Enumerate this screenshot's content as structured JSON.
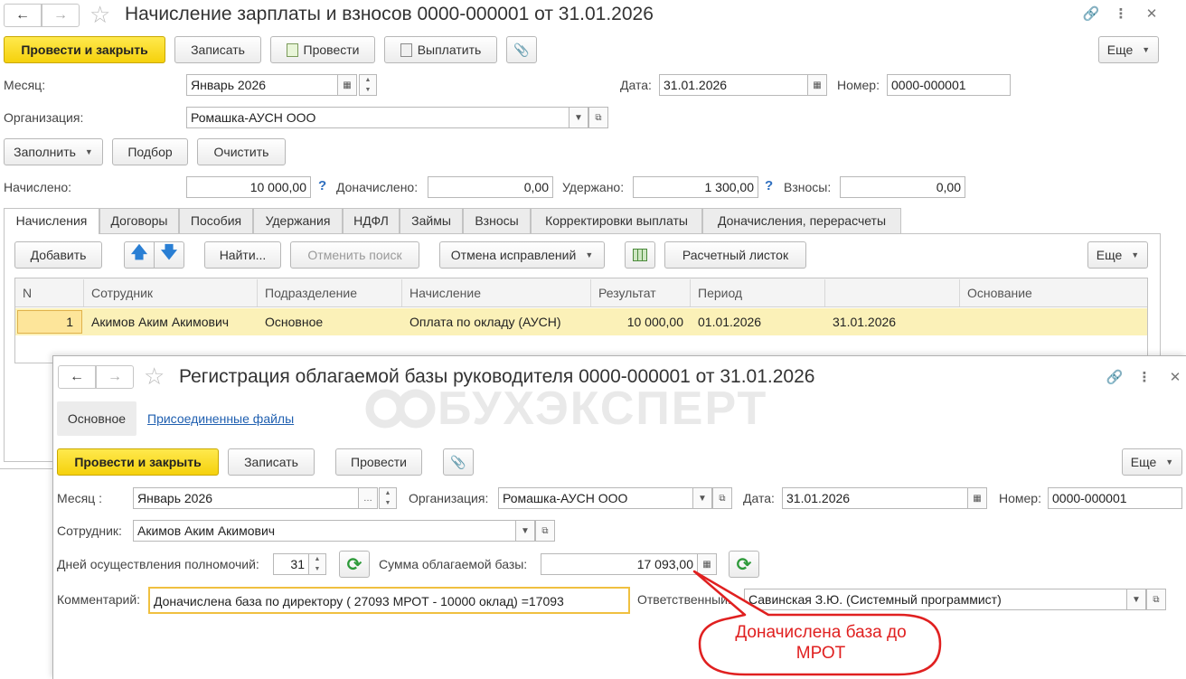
{
  "main": {
    "title": "Начисление зарплаты и взносов 0000-000001 от 31.01.2026",
    "toolbar": {
      "post_close": "Провести и закрыть",
      "save": "Записать",
      "post": "Провести",
      "pay": "Выплатить",
      "more": "Еще"
    },
    "month_label": "Месяц:",
    "month_value": "Январь 2026",
    "date_label": "Дата:",
    "date_value": "31.01.2026",
    "number_label": "Номер:",
    "number_value": "0000-000001",
    "org_label": "Организация:",
    "org_value": "Ромашка-АУСН ООО",
    "fill": "Заполнить",
    "select": "Подбор",
    "clear": "Очистить",
    "accrued_label": "Начислено:",
    "accrued_value": "10 000,00",
    "additional_label": "Доначислено:",
    "additional_value": "0,00",
    "withheld_label": "Удержано:",
    "withheld_value": "1 300,00",
    "contrib_label": "Взносы:",
    "contrib_value": "0,00",
    "q": "?",
    "tabs": [
      "Начисления",
      "Договоры",
      "Пособия",
      "Удержания",
      "НДФЛ",
      "Займы",
      "Взносы",
      "Корректировки выплаты",
      "Доначисления, перерасчеты"
    ],
    "table_toolbar": {
      "add": "Добавить",
      "find": "Найти...",
      "cancel_search": "Отменить поиск",
      "cancel_corrections": "Отмена исправлений",
      "payslip": "Расчетный листок",
      "more": "Еще"
    },
    "table": {
      "headers": [
        "N",
        "Сотрудник",
        "Подразделение",
        "Начисление",
        "Результат",
        "Период",
        "",
        "Основание"
      ],
      "rows": [
        [
          "1",
          "Акимов Аким Акимович",
          "Основное",
          "Оплата по окладу (АУСН)",
          "10 000,00",
          "01.01.2026",
          "31.01.2026",
          ""
        ]
      ]
    }
  },
  "dialog": {
    "title": "Регистрация облагаемой базы руководителя 0000-000001 от 31.01.2026",
    "tab_main": "Основное",
    "tab_files": "Присоединенные файлы",
    "watermark": "БУХЭКСПЕРТ",
    "toolbar": {
      "post_close": "Провести и закрыть",
      "save": "Записать",
      "post": "Провести",
      "more": "Еще"
    },
    "month_label": "Месяц :",
    "month_value": "Январь 2026",
    "org_label": "Организация:",
    "org_value": "Ромашка-АУСН ООО",
    "date_label": "Дата:",
    "date_value": "31.01.2026",
    "number_label": "Номер:",
    "number_value": "0000-000001",
    "employee_label": "Сотрудник:",
    "employee_value": "Акимов Аким Акимович",
    "days_label": "Дней осуществления полномочий:",
    "days_value": "31",
    "base_label": "Сумма облагаемой базы:",
    "base_value": "17 093,00",
    "comment_label": "Комментарий:",
    "comment_value": "Доначислена база по директору ( 27093 МРОТ - 10000 оклад) =17093",
    "responsible_label": "Ответственный:",
    "responsible_value": "Савинская З.Ю. (Системный программист)"
  },
  "callout": "Доначислена база до МРОТ",
  "colors": {
    "accent_yellow": "#f5d10c",
    "row_highlight": "#fbf1b8",
    "link_blue": "#1f5fb0",
    "callout_red": "#e02020",
    "refresh_green": "#2e9a3a",
    "arrow_blue": "#2a7fd4"
  }
}
